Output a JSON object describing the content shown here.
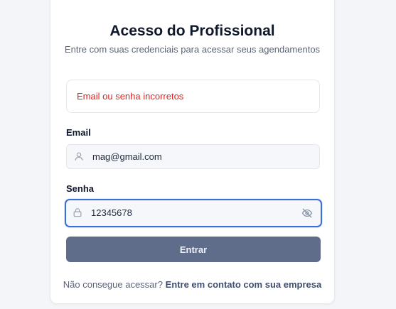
{
  "login": {
    "title": "Acesso do Profissional",
    "subtitle": "Entre com suas credenciais para acessar seus agendamentos",
    "error_message": "Email ou senha incorretos",
    "email_label": "Email",
    "email_value": "mag@gmail.com",
    "email_icon": "user-icon",
    "password_label": "Senha",
    "password_value": "12345678",
    "password_icon": "lock-icon",
    "toggle_icon": "eye-off-icon",
    "submit_label": "Entrar",
    "footer_text": "Não consegue acessar?",
    "footer_link": "Entre em contato com sua empresa"
  },
  "colors": {
    "error": "#dc2626",
    "focus_ring": "#3b6fd8",
    "button_bg": "#5f6c8a"
  }
}
